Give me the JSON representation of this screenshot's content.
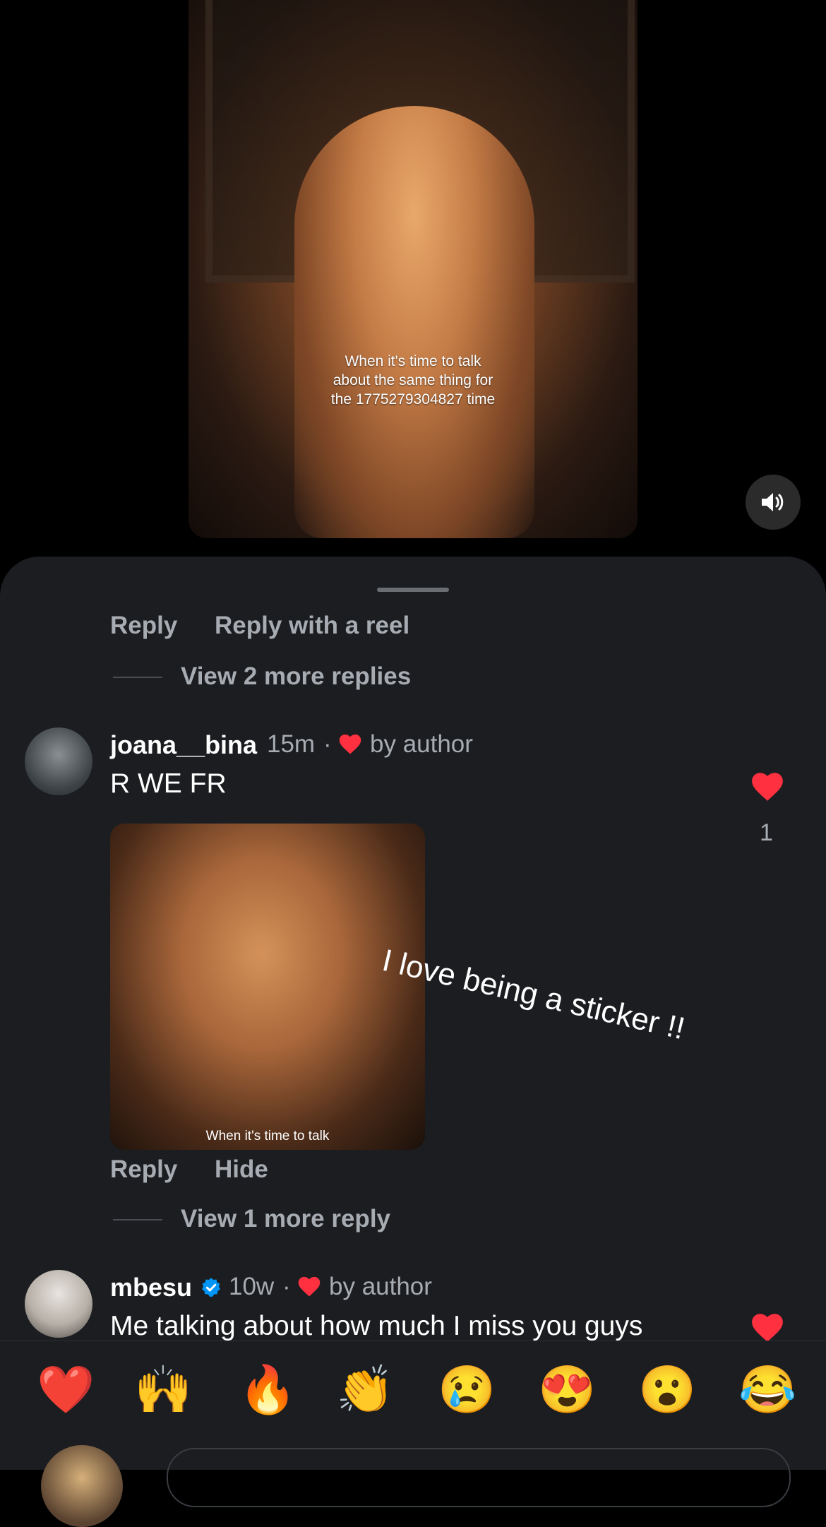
{
  "video": {
    "caption_line1": "When it's time to talk",
    "caption_line2": "about the same thing for",
    "caption_line3": "the 1775279304827 time",
    "sound_icon": "speaker-on-icon"
  },
  "thread1": {
    "reply_label": "Reply",
    "reply_reel_label": "Reply with a reel",
    "view_more_label": "View 2 more replies"
  },
  "comment1": {
    "username": "joana__bina",
    "time": "15m",
    "separator": "·",
    "liked_by_author": "by author",
    "text": "R WE FR",
    "like_count": "1",
    "thumb_caption": "When it's time to talk",
    "sticker_text": "I love being a sticker !!",
    "reply_label": "Reply",
    "hide_label": "Hide",
    "view_more_label": "View 1 more reply"
  },
  "comment2": {
    "username": "mbesu",
    "time": "10w",
    "separator": "·",
    "liked_by_author": "by author",
    "text": "Me talking about how much I miss you guys"
  },
  "emojis": [
    "❤️",
    "🙌",
    "🔥",
    "👏",
    "😢",
    "😍",
    "😮",
    "😂"
  ],
  "colors": {
    "like_red": "#ff3040",
    "verified_blue": "#0095f6"
  }
}
